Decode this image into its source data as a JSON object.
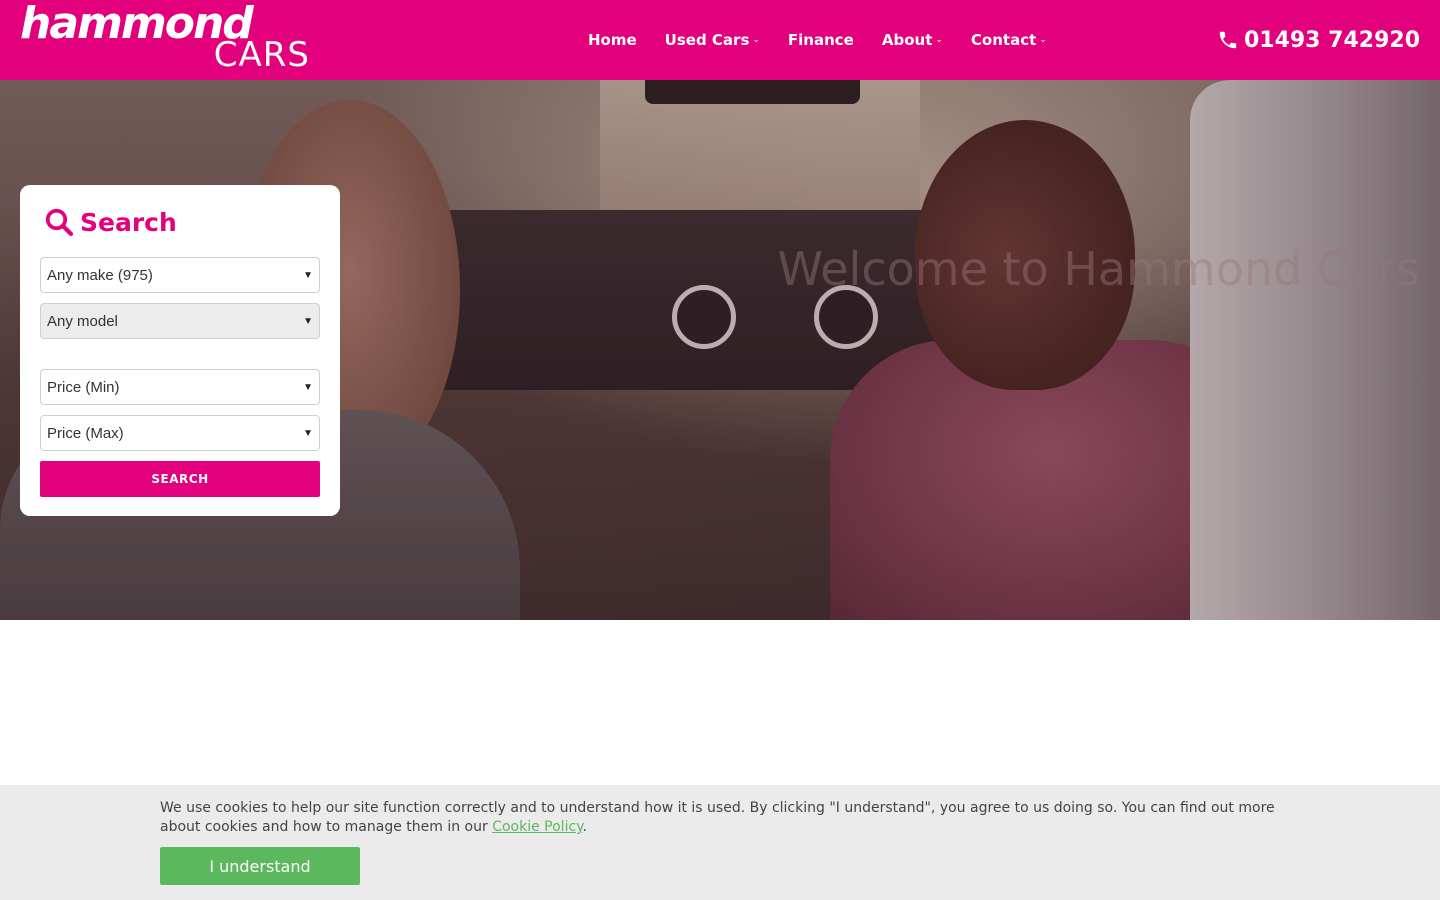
{
  "header": {
    "logo_main": "hammond",
    "logo_sub": "CARS",
    "nav": [
      {
        "label": "Home",
        "has_dropdown": false
      },
      {
        "label": "Used Cars",
        "has_dropdown": true
      },
      {
        "label": "Finance",
        "has_dropdown": false
      },
      {
        "label": "About",
        "has_dropdown": true
      },
      {
        "label": "Contact",
        "has_dropdown": true
      }
    ],
    "phone": "01493 742920"
  },
  "hero": {
    "welcome": "Welcome to Hammond Cars"
  },
  "search": {
    "title": "Search",
    "make": "Any make (975)",
    "model": "Any model",
    "price_min": "Price (Min)",
    "price_max": "Price (Max)",
    "button": "SEARCH"
  },
  "cookie": {
    "text_before": "We use cookies to help our site function correctly and to understand how it is used. By clicking \"I understand\", you agree to us doing so. You can find out more about cookies and how to manage them in our ",
    "link": "Cookie Policy",
    "text_after": ".",
    "button": "I understand"
  },
  "colors": {
    "brand": "#e3007d",
    "accept": "#5cb85c"
  }
}
